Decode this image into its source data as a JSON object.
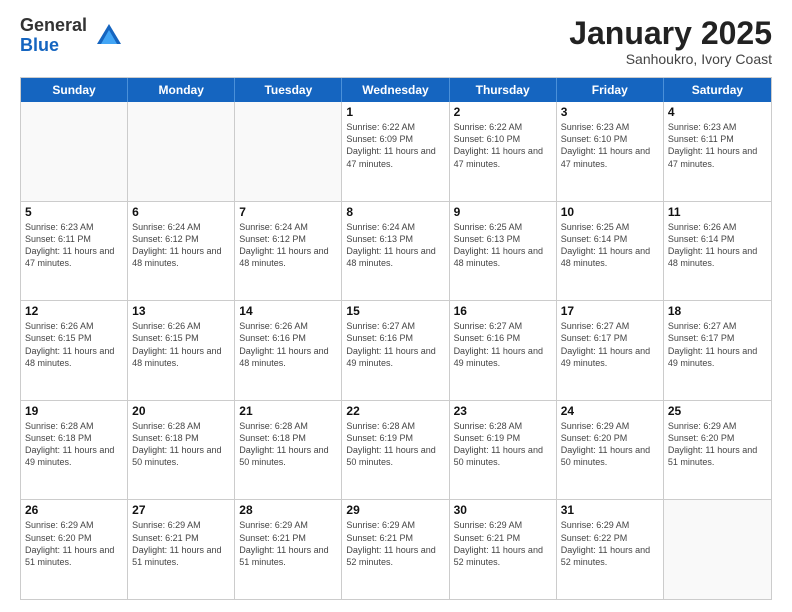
{
  "logo": {
    "general": "General",
    "blue": "Blue"
  },
  "title": "January 2025",
  "subtitle": "Sanhoukro, Ivory Coast",
  "days_of_week": [
    "Sunday",
    "Monday",
    "Tuesday",
    "Wednesday",
    "Thursday",
    "Friday",
    "Saturday"
  ],
  "weeks": [
    [
      {
        "day": "",
        "empty": true
      },
      {
        "day": "",
        "empty": true
      },
      {
        "day": "",
        "empty": true
      },
      {
        "day": "1",
        "sunrise": "6:22 AM",
        "sunset": "6:09 PM",
        "daylight": "11 hours and 47 minutes."
      },
      {
        "day": "2",
        "sunrise": "6:22 AM",
        "sunset": "6:10 PM",
        "daylight": "11 hours and 47 minutes."
      },
      {
        "day": "3",
        "sunrise": "6:23 AM",
        "sunset": "6:10 PM",
        "daylight": "11 hours and 47 minutes."
      },
      {
        "day": "4",
        "sunrise": "6:23 AM",
        "sunset": "6:11 PM",
        "daylight": "11 hours and 47 minutes."
      }
    ],
    [
      {
        "day": "5",
        "sunrise": "6:23 AM",
        "sunset": "6:11 PM",
        "daylight": "11 hours and 47 minutes."
      },
      {
        "day": "6",
        "sunrise": "6:24 AM",
        "sunset": "6:12 PM",
        "daylight": "11 hours and 48 minutes."
      },
      {
        "day": "7",
        "sunrise": "6:24 AM",
        "sunset": "6:12 PM",
        "daylight": "11 hours and 48 minutes."
      },
      {
        "day": "8",
        "sunrise": "6:24 AM",
        "sunset": "6:13 PM",
        "daylight": "11 hours and 48 minutes."
      },
      {
        "day": "9",
        "sunrise": "6:25 AM",
        "sunset": "6:13 PM",
        "daylight": "11 hours and 48 minutes."
      },
      {
        "day": "10",
        "sunrise": "6:25 AM",
        "sunset": "6:14 PM",
        "daylight": "11 hours and 48 minutes."
      },
      {
        "day": "11",
        "sunrise": "6:26 AM",
        "sunset": "6:14 PM",
        "daylight": "11 hours and 48 minutes."
      }
    ],
    [
      {
        "day": "12",
        "sunrise": "6:26 AM",
        "sunset": "6:15 PM",
        "daylight": "11 hours and 48 minutes."
      },
      {
        "day": "13",
        "sunrise": "6:26 AM",
        "sunset": "6:15 PM",
        "daylight": "11 hours and 48 minutes."
      },
      {
        "day": "14",
        "sunrise": "6:26 AM",
        "sunset": "6:16 PM",
        "daylight": "11 hours and 48 minutes."
      },
      {
        "day": "15",
        "sunrise": "6:27 AM",
        "sunset": "6:16 PM",
        "daylight": "11 hours and 49 minutes."
      },
      {
        "day": "16",
        "sunrise": "6:27 AM",
        "sunset": "6:16 PM",
        "daylight": "11 hours and 49 minutes."
      },
      {
        "day": "17",
        "sunrise": "6:27 AM",
        "sunset": "6:17 PM",
        "daylight": "11 hours and 49 minutes."
      },
      {
        "day": "18",
        "sunrise": "6:27 AM",
        "sunset": "6:17 PM",
        "daylight": "11 hours and 49 minutes."
      }
    ],
    [
      {
        "day": "19",
        "sunrise": "6:28 AM",
        "sunset": "6:18 PM",
        "daylight": "11 hours and 49 minutes."
      },
      {
        "day": "20",
        "sunrise": "6:28 AM",
        "sunset": "6:18 PM",
        "daylight": "11 hours and 50 minutes."
      },
      {
        "day": "21",
        "sunrise": "6:28 AM",
        "sunset": "6:18 PM",
        "daylight": "11 hours and 50 minutes."
      },
      {
        "day": "22",
        "sunrise": "6:28 AM",
        "sunset": "6:19 PM",
        "daylight": "11 hours and 50 minutes."
      },
      {
        "day": "23",
        "sunrise": "6:28 AM",
        "sunset": "6:19 PM",
        "daylight": "11 hours and 50 minutes."
      },
      {
        "day": "24",
        "sunrise": "6:29 AM",
        "sunset": "6:20 PM",
        "daylight": "11 hours and 50 minutes."
      },
      {
        "day": "25",
        "sunrise": "6:29 AM",
        "sunset": "6:20 PM",
        "daylight": "11 hours and 51 minutes."
      }
    ],
    [
      {
        "day": "26",
        "sunrise": "6:29 AM",
        "sunset": "6:20 PM",
        "daylight": "11 hours and 51 minutes."
      },
      {
        "day": "27",
        "sunrise": "6:29 AM",
        "sunset": "6:21 PM",
        "daylight": "11 hours and 51 minutes."
      },
      {
        "day": "28",
        "sunrise": "6:29 AM",
        "sunset": "6:21 PM",
        "daylight": "11 hours and 51 minutes."
      },
      {
        "day": "29",
        "sunrise": "6:29 AM",
        "sunset": "6:21 PM",
        "daylight": "11 hours and 52 minutes."
      },
      {
        "day": "30",
        "sunrise": "6:29 AM",
        "sunset": "6:21 PM",
        "daylight": "11 hours and 52 minutes."
      },
      {
        "day": "31",
        "sunrise": "6:29 AM",
        "sunset": "6:22 PM",
        "daylight": "11 hours and 52 minutes."
      },
      {
        "day": "",
        "empty": true
      }
    ]
  ]
}
